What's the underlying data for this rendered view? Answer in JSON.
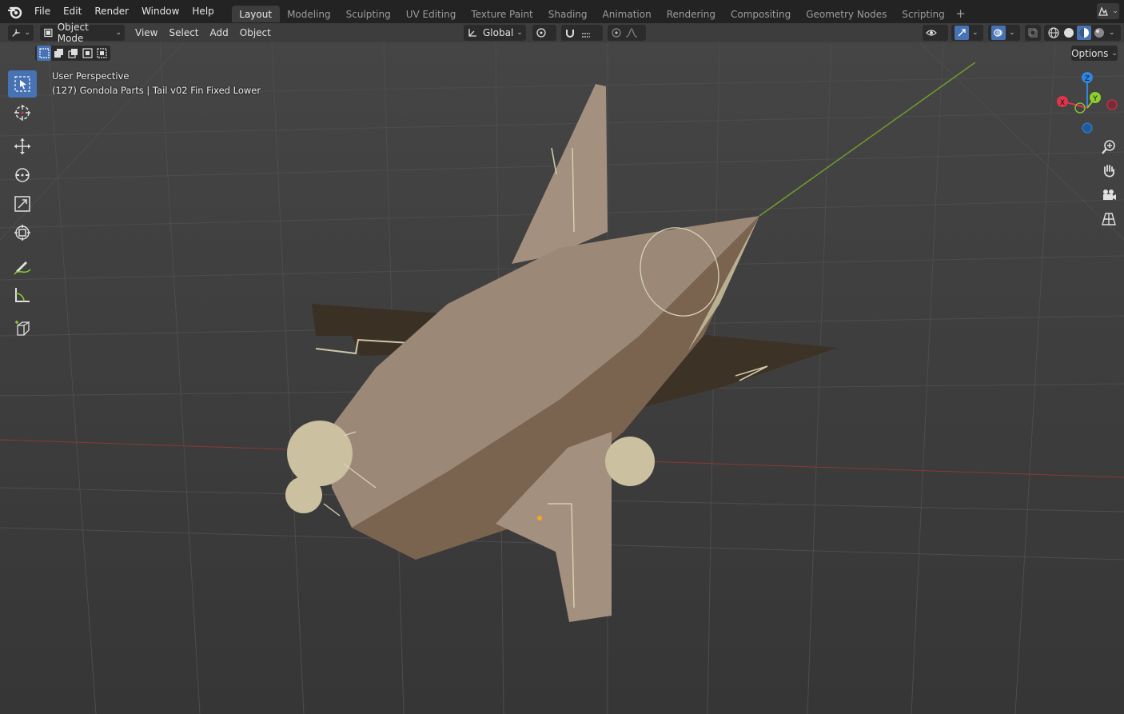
{
  "topbar": {
    "menus": [
      "File",
      "Edit",
      "Render",
      "Window",
      "Help"
    ],
    "workspaces": [
      "Layout",
      "Modeling",
      "Sculpting",
      "UV Editing",
      "Texture Paint",
      "Shading",
      "Animation",
      "Rendering",
      "Compositing",
      "Geometry Nodes",
      "Scripting"
    ],
    "active_workspace": "Layout",
    "add_tab_symbol": "+"
  },
  "header": {
    "mode": "Object Mode",
    "menus": [
      "View",
      "Select",
      "Add",
      "Object"
    ],
    "transform_orientation": "Global",
    "options": "Options"
  },
  "viewport": {
    "view_name": "User Perspective",
    "object_info": "(127) Gondola Parts | Tail v02 Fin Fixed Lower",
    "gizmo": {
      "x": "X",
      "y": "Y",
      "z": "Z"
    }
  },
  "icons": {
    "blender": "blender-logo-icon",
    "editor_type": "viewport-editor-icon",
    "tools": [
      "select-box-icon",
      "cursor-icon",
      "move-icon",
      "rotate-icon",
      "scale-icon",
      "transform-icon",
      "annotate-icon",
      "measure-icon",
      "add-cube-icon"
    ]
  },
  "colors": {
    "accent": "#4772b3",
    "axis_x": "#e0344a",
    "axis_y": "#8ccf2e",
    "axis_z": "#2f86e0",
    "y_axis_line": "#6f9a2c",
    "x_axis_line": "#9b3a3a",
    "model": "#a3907e"
  }
}
